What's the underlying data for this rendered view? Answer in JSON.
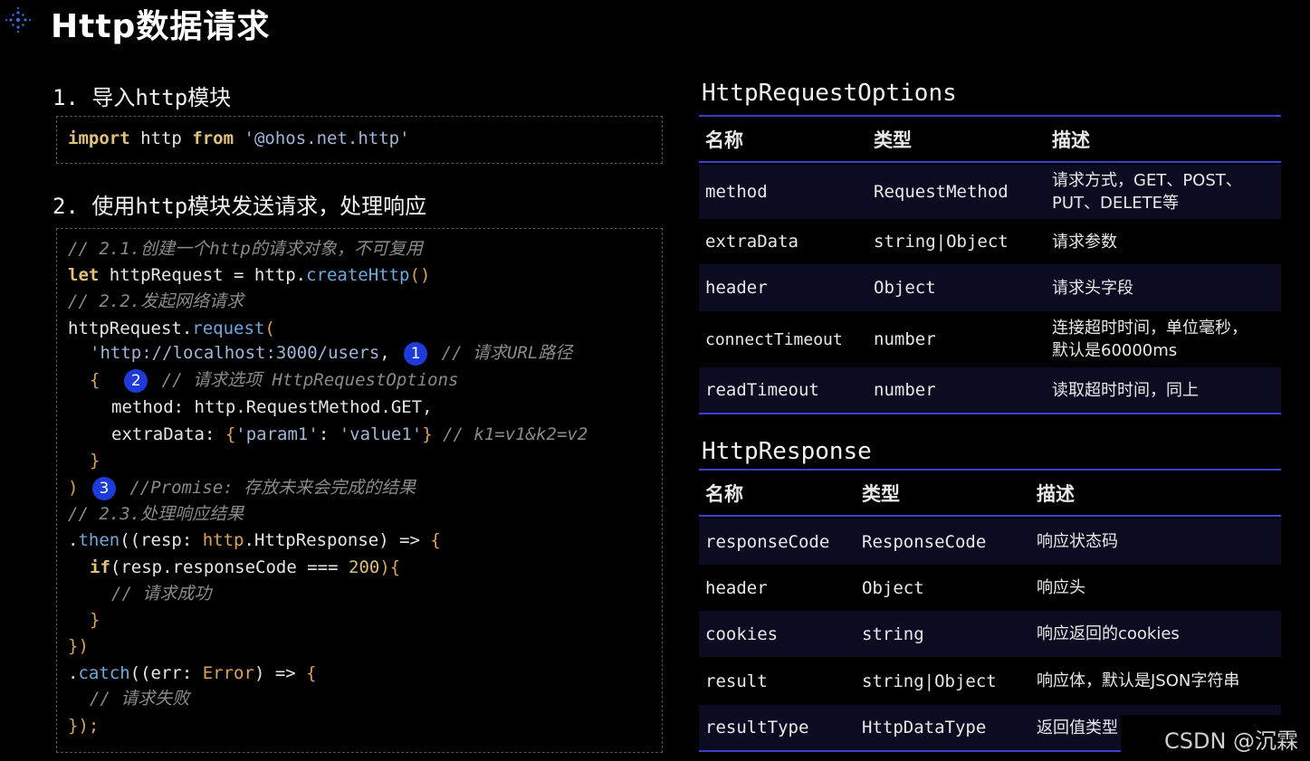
{
  "page": {
    "title": "Http数据请求",
    "icon": "snowflake-icon"
  },
  "section1": {
    "heading": "1. 导入http模块",
    "code": {
      "kw1": "import",
      "mid": " http ",
      "kw2": "from",
      "space": " ",
      "str": "'@ohos.net.http'"
    }
  },
  "section2": {
    "heading": "2. 使用http模块发送请求，处理响应",
    "lines": {
      "c1": "// 2.1.创建一个http的请求对象，不可复用",
      "l2_kw": "let",
      "l2_a": " httpRequest = http.",
      "l2_fn": "createHttp",
      "l2_b": "()",
      "c3": "// 2.2.发起网络请求",
      "l4_a": "httpRequest.",
      "l4_fn": "request",
      "l4_b": "(",
      "l5_str": "'http://localhost:3000/users",
      "l5_b": ",",
      "l5_badge": "1",
      "l5_cm": "// 请求URL路径",
      "l6_br": "{",
      "l6_badge": "2",
      "l6_cm": "// 请求选项 HttpRequestOptions",
      "l7": "method: http.RequestMethod.GET,",
      "l8_a": "extraData: ",
      "l8_br1": "{",
      "l8_s1": "'param1'",
      "l8_c": ": ",
      "l8_s2": "'value1'",
      "l8_br2": "}",
      "l8_cm": " // k1=v1&k2=v2",
      "l9": "}",
      "l10_br": ")",
      "l10_badge": "3",
      "l10_cm": "//Promise: 存放未来会完成的结果",
      "c11": "// 2.3.处理响应结果",
      "l12_a": ".",
      "l12_fn": "then",
      "l12_b": "((resp: ",
      "l12_ty": "http",
      "l12_c": ".HttpResponse) => ",
      "l12_br": "{",
      "l13_kw": "if",
      "l13_a": "(resp.responseCode === ",
      "l13_num": "200",
      "l13_b": "){",
      "l14_cm": "// 请求成功",
      "l15": "}",
      "l16": "})",
      "l17_a": ".",
      "l17_fn": "catch",
      "l17_b": "((err: ",
      "l17_ty": "Error",
      "l17_c": ") => ",
      "l17_br": "{",
      "l18_cm": "// 请求失败",
      "l19": "});"
    }
  },
  "table1": {
    "title": "HttpRequestOptions",
    "headers": [
      "名称",
      "类型",
      "描述"
    ],
    "rows": [
      [
        "method",
        "RequestMethod",
        "请求方式，GET、POST、PUT、DELETE等"
      ],
      [
        "extraData",
        "string|Object",
        "请求参数"
      ],
      [
        "header",
        "Object",
        "请求头字段"
      ],
      [
        "connectTimeout",
        "number",
        "连接超时时间，单位毫秒，默认是60000ms"
      ],
      [
        "readTimeout",
        "number",
        "读取超时时间，同上"
      ]
    ]
  },
  "table2": {
    "title": "HttpResponse",
    "headers": [
      "名称",
      "类型",
      "描述"
    ],
    "rows": [
      [
        "responseCode",
        "ResponseCode",
        "响应状态码"
      ],
      [
        "header",
        "Object",
        "响应头"
      ],
      [
        "cookies",
        "string",
        "响应返回的cookies"
      ],
      [
        "result",
        "string|Object",
        "响应体，默认是JSON字符串"
      ],
      [
        "resultType",
        "HttpDataType",
        "返回值类型"
      ]
    ]
  },
  "watermark": "CSDN @沉霖",
  "colors": {
    "accent": "#3b3fd0",
    "badge": "#1e3ad8",
    "keyword": "#e2c27a",
    "string": "#9fb6d8",
    "comment": "#8a8a8a"
  }
}
